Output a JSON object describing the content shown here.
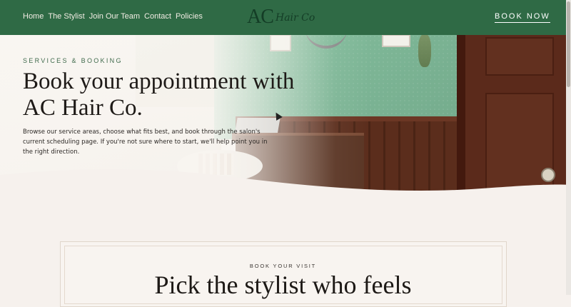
{
  "nav": {
    "links": [
      "Home",
      "The Stylist",
      "Join Our Team",
      "Contact",
      "Policies"
    ],
    "logo_main": "AC",
    "logo_script": "Hair Co",
    "book_now": "BOOK NOW"
  },
  "hero": {
    "eyebrow": "SERVICES & BOOKING",
    "headline_line1": "Book your appointment with",
    "headline_line2": "AC Hair Co.",
    "intro": "Browse our service areas, choose what fits best, and book through the salon's current scheduling page. If you're not sure where to start, we'll help point you in the right direction."
  },
  "section": {
    "eyebrow": "BOOK YOUR VISIT",
    "title": "Pick the stylist who feels"
  },
  "colors": {
    "nav_green": "#2f6a45",
    "logo_green": "#143d26",
    "page_bg": "#f6f1ed",
    "text_dark": "#1e1a17"
  }
}
